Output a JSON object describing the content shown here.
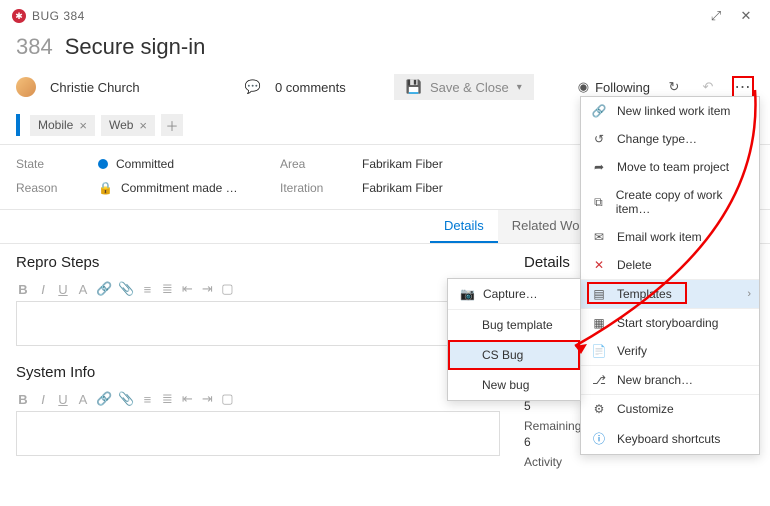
{
  "header": {
    "type_label": "BUG 384"
  },
  "title": {
    "number": "384",
    "text": "Secure sign-in"
  },
  "assignee": {
    "name": "Christie Church"
  },
  "comments": {
    "label": "0 comments"
  },
  "save_close": {
    "label": "Save & Close"
  },
  "following": {
    "label": "Following"
  },
  "tags": [
    {
      "label": "Mobile"
    },
    {
      "label": "Web"
    }
  ],
  "fields": {
    "state_label": "State",
    "state_value": "Committed",
    "area_label": "Area",
    "area_value": "Fabrikam Fiber",
    "reason_label": "Reason",
    "reason_value": "Commitment made …",
    "iteration_label": "Iteration",
    "iteration_value": "Fabrikam Fiber"
  },
  "tabs": {
    "details": "Details",
    "related": "Related Work item"
  },
  "sections": {
    "repro": "Repro Steps",
    "sysinfo": "System Info",
    "details": "Details"
  },
  "details_panel": {
    "value1": "5",
    "remaining_label": "Remaining Work",
    "remaining_value": "6",
    "activity_label": "Activity"
  },
  "capture_menu": {
    "capture": "Capture…",
    "bug_template": "Bug template",
    "cs_bug": "CS Bug",
    "new_bug": "New bug"
  },
  "main_menu": {
    "new_linked": "New linked work item",
    "change_type": "Change type…",
    "move_team": "Move to team project",
    "create_copy": "Create copy of work item…",
    "email": "Email work item",
    "delete": "Delete",
    "templates": "Templates",
    "start_story": "Start storyboarding",
    "verify": "Verify",
    "new_branch": "New branch…",
    "customize": "Customize",
    "shortcuts": "Keyboard shortcuts"
  }
}
